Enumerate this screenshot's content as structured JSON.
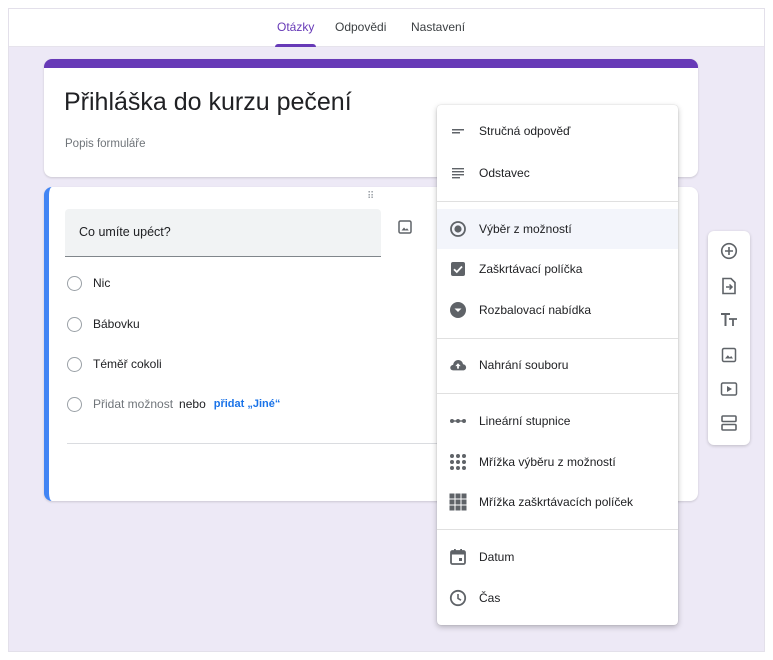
{
  "tabs": [
    {
      "label": "Otázky",
      "active": true
    },
    {
      "label": "Odpovědi",
      "active": false
    },
    {
      "label": "Nastavení",
      "active": false
    }
  ],
  "form": {
    "title": "Přihláška do kurzu pečení",
    "description_placeholder": "Popis formuláře"
  },
  "question": {
    "text": "Co umíte upéct?",
    "options": [
      "Nic",
      "Bábovku",
      "Téměř cokoli"
    ],
    "add_option": "Přidat možnost",
    "or_word": "nebo",
    "add_other": "přidat „Jiné“",
    "drag_handle": "⠿"
  },
  "type_menu": {
    "items": [
      {
        "label": "Stručná odpověď",
        "icon": "short-answer-icon"
      },
      {
        "label": "Odstavec",
        "icon": "paragraph-icon"
      },
      {
        "label": "Výběr z možností",
        "icon": "radio-button-icon",
        "highlighted": true
      },
      {
        "label": "Zaškrtávací políčka",
        "icon": "checkbox-icon"
      },
      {
        "label": "Rozbalovací nabídka",
        "icon": "dropdown-icon"
      },
      {
        "label": "Nahrání souboru",
        "icon": "cloud-upload-icon"
      },
      {
        "label": "Lineární stupnice",
        "icon": "linear-scale-icon"
      },
      {
        "label": "Mřížka výběru z možností",
        "icon": "multiple-choice-grid-icon"
      },
      {
        "label": "Mřížka zaškrtávacích políček",
        "icon": "checkbox-grid-icon"
      },
      {
        "label": "Datum",
        "icon": "calendar-icon"
      },
      {
        "label": "Čas",
        "icon": "clock-icon"
      }
    ]
  },
  "side_toolbar": [
    "add-question-icon",
    "import-questions-icon",
    "add-title-icon",
    "add-image-icon",
    "add-video-icon",
    "add-section-icon"
  ],
  "colors": {
    "accent": "#673ab7",
    "active_question_border": "#4285f4",
    "link": "#1a73e8",
    "background": "#ede9f6"
  }
}
